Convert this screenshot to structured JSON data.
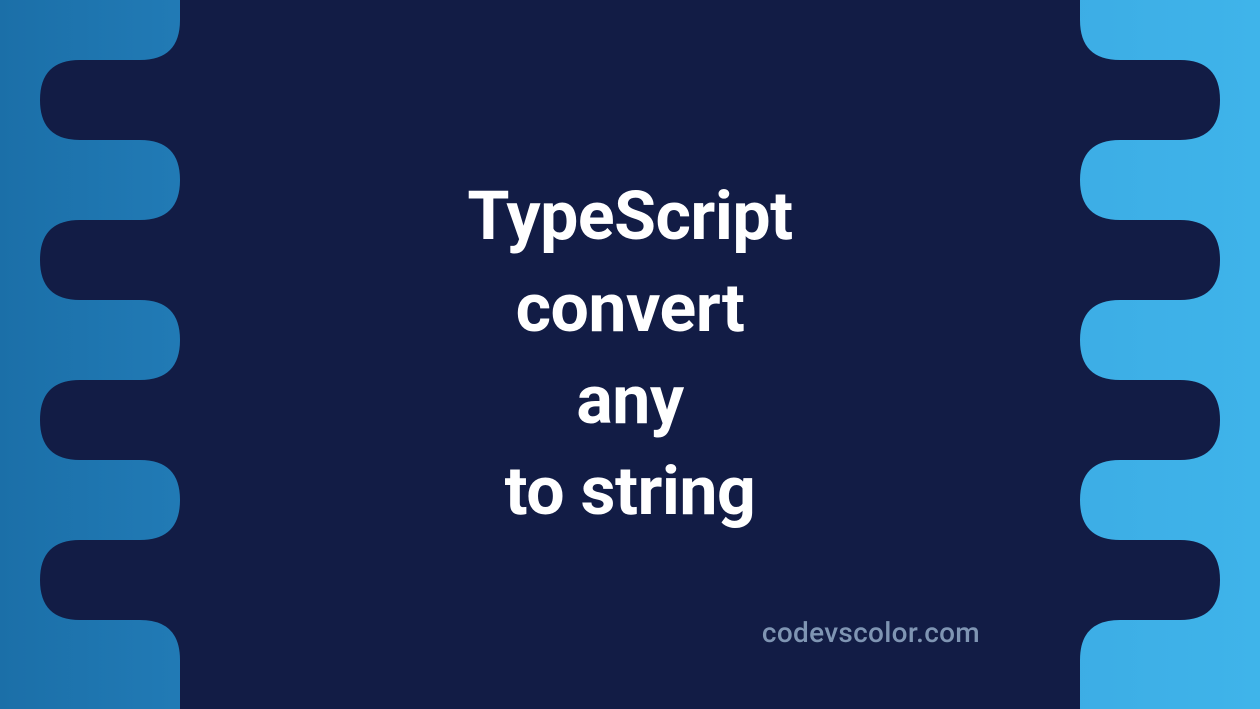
{
  "title": {
    "line1": "TypeScript",
    "line2": "convert",
    "line3": "any",
    "line4": "to string"
  },
  "watermark": "codevscolor.com",
  "colors": {
    "blob": "#121c45",
    "text": "#ffffff",
    "watermark": "#7f95b3"
  }
}
